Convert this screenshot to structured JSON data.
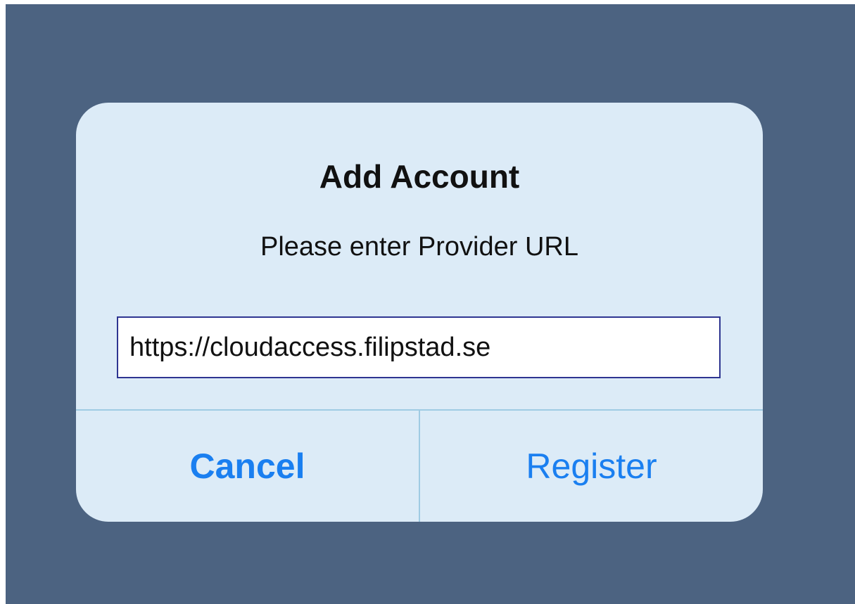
{
  "dialog": {
    "title": "Add Account",
    "message": "Please enter Provider URL",
    "url_value": "https://cloudaccess.filipstad.se",
    "cancel_label": "Cancel",
    "register_label": "Register"
  },
  "colors": {
    "backdrop": "#4c6381",
    "dialog_background": "#dcebf7",
    "button_text": "#1a7ff0",
    "divider": "#9fcbe3",
    "input_border": "#2e3591"
  }
}
